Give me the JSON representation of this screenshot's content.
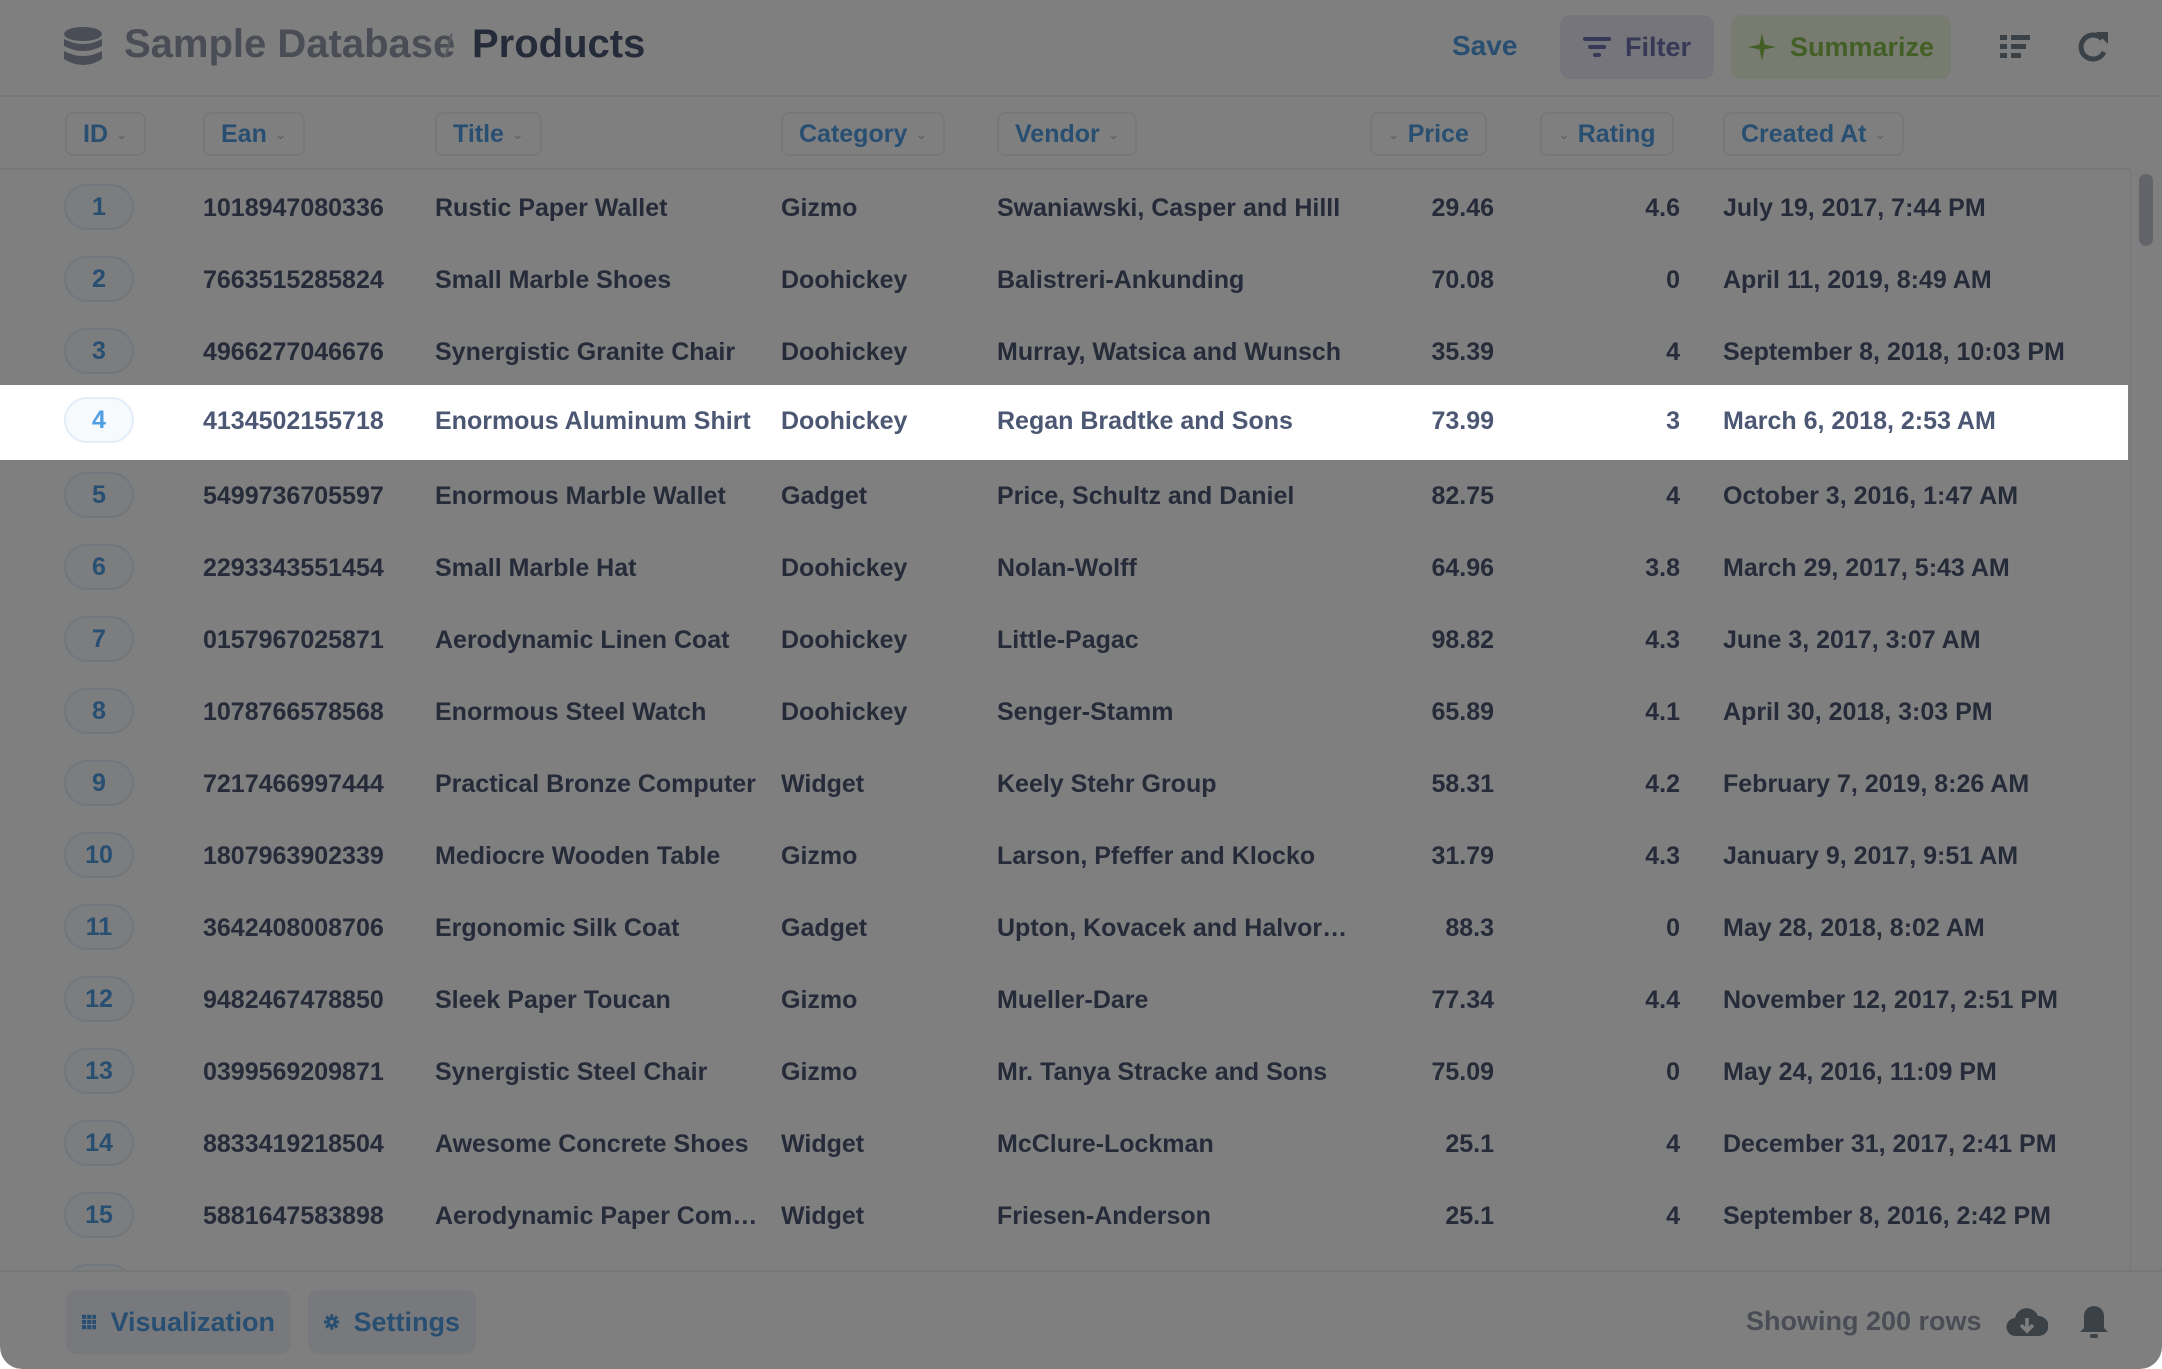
{
  "header": {
    "database": "Sample Database",
    "separator": "/",
    "table": "Products",
    "save_label": "Save",
    "filter_label": "Filter",
    "summarize_label": "Summarize",
    "icons": [
      "database-icon",
      "filter-icon",
      "summarize-sparkle-icon",
      "list-icon",
      "refresh-icon"
    ]
  },
  "columns": [
    {
      "key": "id",
      "label": "ID"
    },
    {
      "key": "ean",
      "label": "Ean"
    },
    {
      "key": "title",
      "label": "Title"
    },
    {
      "key": "category",
      "label": "Category"
    },
    {
      "key": "vendor",
      "label": "Vendor"
    },
    {
      "key": "price",
      "label": "Price"
    },
    {
      "key": "rating",
      "label": "Rating"
    },
    {
      "key": "created_at",
      "label": "Created At"
    }
  ],
  "highlighted_row": 4,
  "rows": [
    {
      "id": "1",
      "ean": "1018947080336",
      "title": "Rustic Paper Wallet",
      "category": "Gizmo",
      "vendor": "Swaniawski, Casper and Hilll",
      "price": "29.46",
      "rating": "4.6",
      "created_at": "July 19, 2017, 7:44 PM"
    },
    {
      "id": "2",
      "ean": "7663515285824",
      "title": "Small Marble Shoes",
      "category": "Doohickey",
      "vendor": "Balistreri-Ankunding",
      "price": "70.08",
      "rating": "0",
      "created_at": "April 11, 2019, 8:49 AM"
    },
    {
      "id": "3",
      "ean": "4966277046676",
      "title": "Synergistic Granite Chair",
      "category": "Doohickey",
      "vendor": "Murray, Watsica and Wunsch",
      "price": "35.39",
      "rating": "4",
      "created_at": "September 8, 2018, 10:03 PM"
    },
    {
      "id": "4",
      "ean": "4134502155718",
      "title": "Enormous Aluminum Shirt",
      "category": "Doohickey",
      "vendor": "Regan Bradtke and Sons",
      "price": "73.99",
      "rating": "3",
      "created_at": "March 6, 2018, 2:53 AM"
    },
    {
      "id": "5",
      "ean": "5499736705597",
      "title": "Enormous Marble Wallet",
      "category": "Gadget",
      "vendor": "Price, Schultz and Daniel",
      "price": "82.75",
      "rating": "4",
      "created_at": "October 3, 2016, 1:47 AM"
    },
    {
      "id": "6",
      "ean": "2293343551454",
      "title": "Small Marble Hat",
      "category": "Doohickey",
      "vendor": "Nolan-Wolff",
      "price": "64.96",
      "rating": "3.8",
      "created_at": "March 29, 2017, 5:43 AM"
    },
    {
      "id": "7",
      "ean": "0157967025871",
      "title": "Aerodynamic Linen Coat",
      "category": "Doohickey",
      "vendor": "Little-Pagac",
      "price": "98.82",
      "rating": "4.3",
      "created_at": "June 3, 2017, 3:07 AM"
    },
    {
      "id": "8",
      "ean": "1078766578568",
      "title": "Enormous Steel Watch",
      "category": "Doohickey",
      "vendor": "Senger-Stamm",
      "price": "65.89",
      "rating": "4.1",
      "created_at": "April 30, 2018, 3:03 PM"
    },
    {
      "id": "9",
      "ean": "7217466997444",
      "title": "Practical Bronze Computer",
      "category": "Widget",
      "vendor": "Keely Stehr Group",
      "price": "58.31",
      "rating": "4.2",
      "created_at": "February 7, 2019, 8:26 AM"
    },
    {
      "id": "10",
      "ean": "1807963902339",
      "title": "Mediocre Wooden Table",
      "category": "Gizmo",
      "vendor": "Larson, Pfeffer and Klocko",
      "price": "31.79",
      "rating": "4.3",
      "created_at": "January 9, 2017, 9:51 AM"
    },
    {
      "id": "11",
      "ean": "3642408008706",
      "title": "Ergonomic Silk Coat",
      "category": "Gadget",
      "vendor": "Upton, Kovacek and Halvor…",
      "price": "88.3",
      "rating": "0",
      "created_at": "May 28, 2018, 8:02 AM"
    },
    {
      "id": "12",
      "ean": "9482467478850",
      "title": "Sleek Paper Toucan",
      "category": "Gizmo",
      "vendor": "Mueller-Dare",
      "price": "77.34",
      "rating": "4.4",
      "created_at": "November 12, 2017, 2:51 PM"
    },
    {
      "id": "13",
      "ean": "0399569209871",
      "title": "Synergistic Steel Chair",
      "category": "Gizmo",
      "vendor": "Mr. Tanya Stracke and Sons",
      "price": "75.09",
      "rating": "0",
      "created_at": "May 24, 2016, 11:09 PM"
    },
    {
      "id": "14",
      "ean": "8833419218504",
      "title": "Awesome Concrete Shoes",
      "category": "Widget",
      "vendor": "McClure-Lockman",
      "price": "25.1",
      "rating": "4",
      "created_at": "December 31, 2017, 2:41 PM"
    },
    {
      "id": "15",
      "ean": "5881647583898",
      "title": "Aerodynamic Paper Com…",
      "category": "Widget",
      "vendor": "Friesen-Anderson",
      "price": "25.1",
      "rating": "4",
      "created_at": "September 8, 2016, 2:42 PM"
    }
  ],
  "footer": {
    "visualization_label": "Visualization",
    "settings_label": "Settings",
    "row_count": "Showing 200 rows"
  },
  "colors": {
    "brand": "#509ee3",
    "filter": "#7172ad",
    "summarize": "#88bf4d",
    "text": "#4c5773",
    "overlay": "rgba(0,0,0,0.5)"
  }
}
